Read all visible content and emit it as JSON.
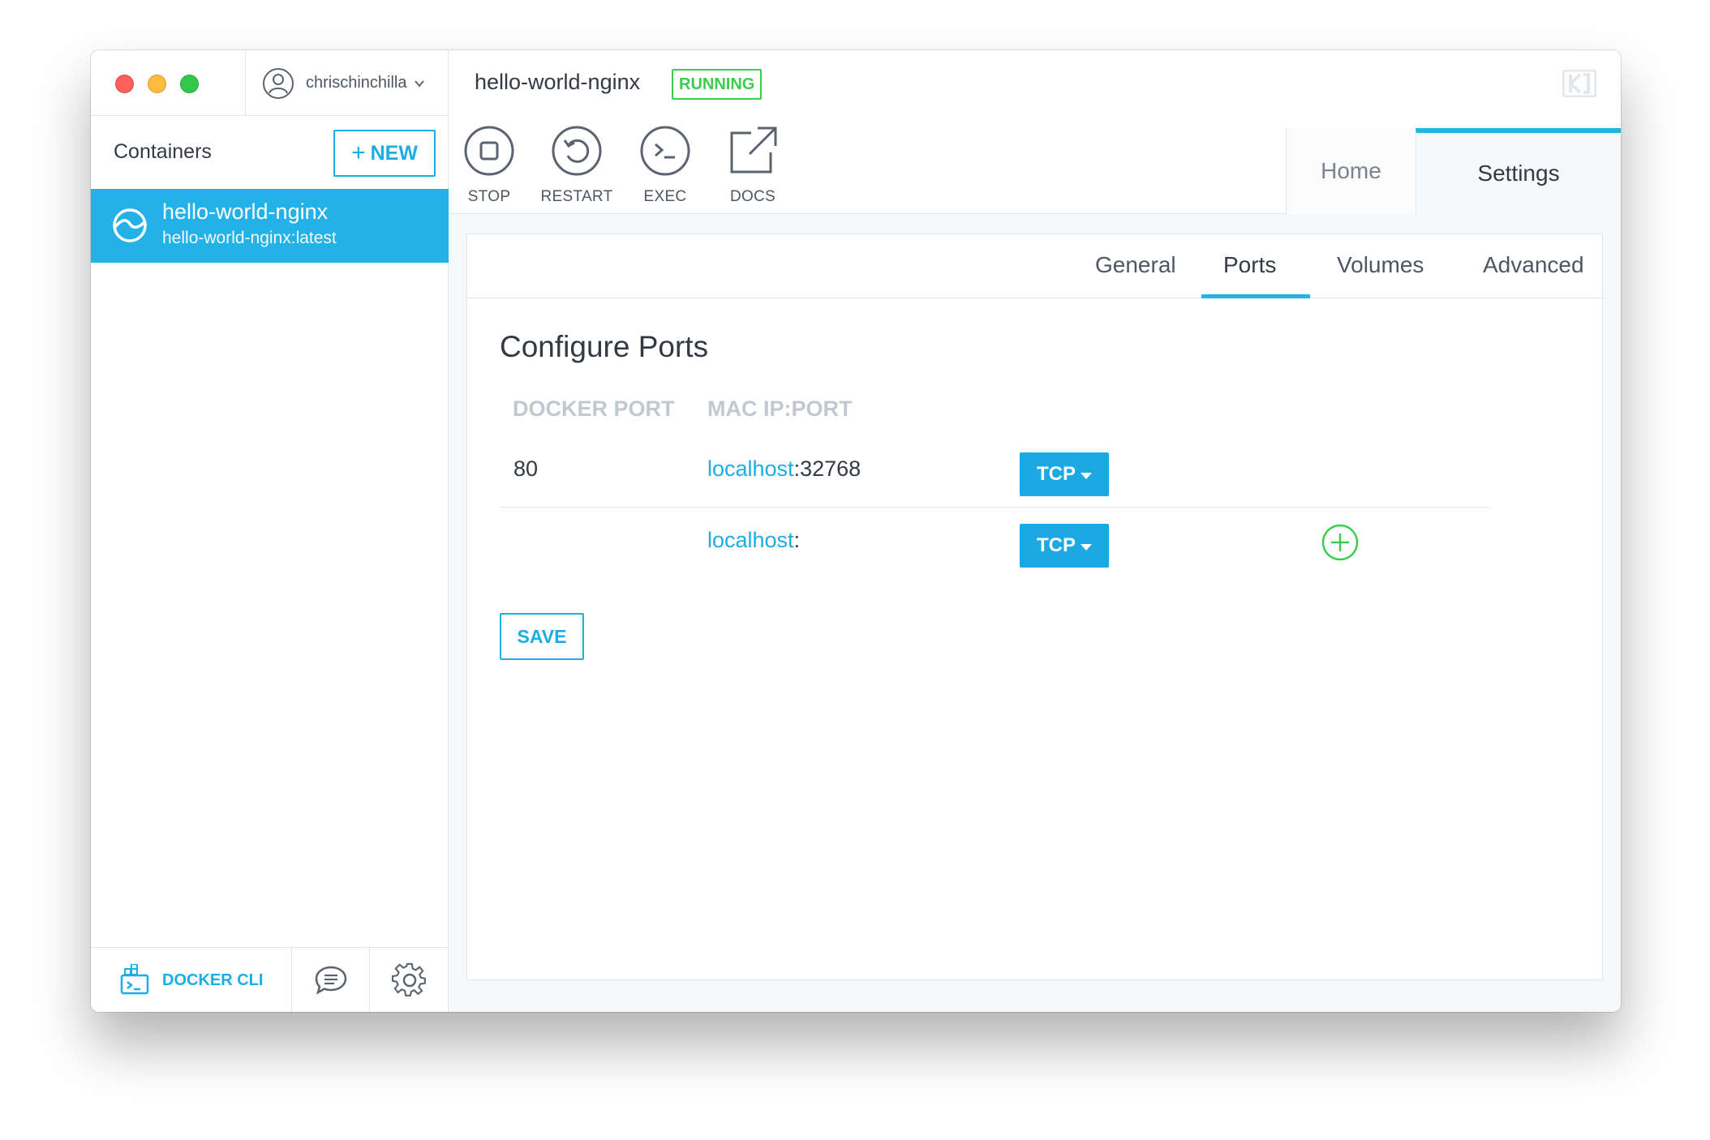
{
  "sidebar": {
    "account": {
      "username": "chrischinchilla",
      "icons": [
        "user-circle-icon",
        "chevron-down-icon"
      ]
    },
    "containers_title": "Containers",
    "new_button": {
      "icon": "plus-icon",
      "label": "NEW"
    },
    "containers": [
      {
        "name": "hello-world-nginx",
        "image": "hello-world-nginx:latest",
        "icon": "container-logo-icon",
        "selected": true
      }
    ],
    "footer": {
      "docker_cli_label": "DOCKER CLI",
      "icons": [
        "docker-cli-icon",
        "chat-bubble-icon",
        "gear-icon"
      ]
    }
  },
  "header": {
    "container_name": "hello-world-nginx",
    "status": "RUNNING",
    "actions": [
      {
        "label": "STOP",
        "icon": "stop-icon"
      },
      {
        "label": "RESTART",
        "icon": "restart-icon"
      },
      {
        "label": "EXEC",
        "icon": "terminal-icon"
      },
      {
        "label": "DOCS",
        "icon": "external-link-icon"
      }
    ],
    "tabs": [
      {
        "label": "Home",
        "active": false
      },
      {
        "label": "Settings",
        "active": true
      }
    ],
    "brand_icon": "kitematic-logo-icon"
  },
  "settings": {
    "tabs": [
      {
        "label": "General",
        "active": false
      },
      {
        "label": "Ports",
        "active": true
      },
      {
        "label": "Volumes",
        "active": false
      },
      {
        "label": "Advanced",
        "active": false
      }
    ],
    "section_title": "Configure Ports",
    "columns": [
      "DOCKER PORT",
      "MAC IP:PORT"
    ],
    "ports": [
      {
        "docker_port": "80",
        "host": "localhost",
        "separator": ":",
        "mac_port": "32768",
        "protocol": "TCP"
      },
      {
        "docker_port": "",
        "host": "localhost",
        "separator": ":",
        "mac_port": "",
        "protocol": "TCP",
        "add_icon": "plus-circle-icon"
      }
    ],
    "save_label": "SAVE"
  },
  "colors": {
    "accent": "#1bade3",
    "running": "#3ccc4f",
    "selected_bg": "#24b1e7"
  }
}
